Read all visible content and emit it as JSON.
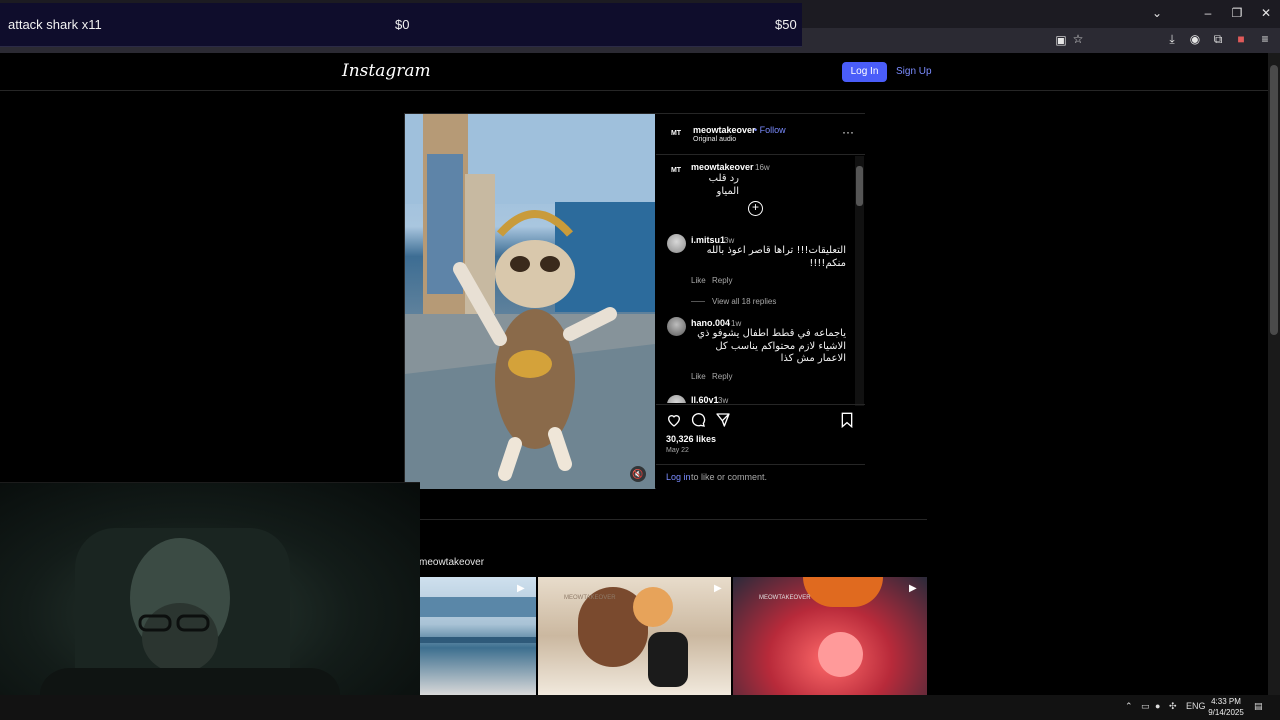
{
  "overlay": {
    "product": "attack shark x11",
    "price_low": "$0",
    "price_high": "$50"
  },
  "header": {
    "logo": "Instagram",
    "login": "Log In",
    "signup": "Sign Up"
  },
  "post": {
    "author": "meowtakeover",
    "follow": "• Follow",
    "audio": "Original audio",
    "avatar_text": "MT",
    "caption": {
      "user": "meowtakeover",
      "time": "16w",
      "text": "رد قلب المياو"
    },
    "comments": [
      {
        "user": "i.mitsu1",
        "time": "3w",
        "text": "التعليقات!!! تراها قاصر اعوذ بالله منكم!!!!",
        "like": "Like",
        "reply": "Reply",
        "replies": "View all 18 replies"
      },
      {
        "user": "hano.004",
        "time": "1w",
        "text": "ياجماعه في قطط اطفال يشوفو ذي الاشياء لازم محتواكم يناسب كل الاعمار مش كذا",
        "like": "Like",
        "reply": "Reply"
      },
      {
        "user": "ll.60v1",
        "time": "3w"
      }
    ],
    "likes": "30,326 likes",
    "date": "May 22",
    "login_prompt_link": "Log in",
    "login_prompt_rest": " to like or comment."
  },
  "more": {
    "title": "meowtakeover",
    "watermark": "MEOWTAKEOVER"
  },
  "taskbar": {
    "lang": "ENG",
    "time": "4:33 PM",
    "date": "9/14/2025"
  }
}
